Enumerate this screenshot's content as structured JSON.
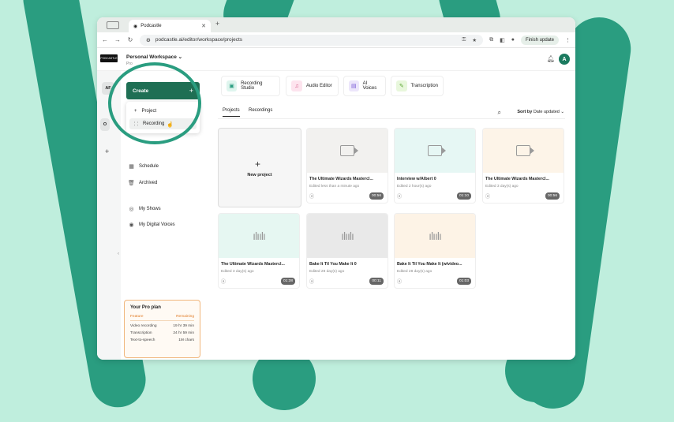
{
  "browser": {
    "tab_title": "Podcastle",
    "url": "podcastle.ai/editor/workspace/projects",
    "finish_update": "Finish update"
  },
  "app": {
    "logo": "PODCASTLE",
    "workspace_name": "Personal Workspace",
    "workspace_plan": "Pro",
    "avatar_initial": "A",
    "rail": [
      "AF",
      "O"
    ]
  },
  "sidebar": {
    "create_label": "Create",
    "create_plus": "+",
    "menu": [
      {
        "label": "Project",
        "icon": "plus-icon"
      },
      {
        "label": "Recording",
        "icon": "grid-icon"
      }
    ],
    "nav": [
      {
        "label": "Schedule",
        "icon": "calendar-icon"
      },
      {
        "label": "Archived",
        "icon": "trash-icon"
      },
      {
        "label": "My Shows",
        "icon": "broadcast-icon"
      },
      {
        "label": "My Digital Voices",
        "icon": "voice-icon"
      }
    ]
  },
  "plan": {
    "title": "Your Pro plan",
    "col_feature": "Feature",
    "col_remaining": "Remaining",
    "rows": [
      {
        "feature": "Video recording",
        "remaining": "19 hr 39 min"
      },
      {
        "feature": "Transcription",
        "remaining": "24 hr 59 min"
      },
      {
        "feature": "Text-to-speech",
        "remaining": "1M chars"
      }
    ]
  },
  "tools": [
    {
      "label": "Recording Studio",
      "color": "#dff5ee"
    },
    {
      "label": "Audio Editor",
      "color": "#fde4ee"
    },
    {
      "label": "AI Voices",
      "color": "#ece6fb"
    },
    {
      "label": "Transcription",
      "color": "#e8f7dc"
    }
  ],
  "tabs": {
    "projects": "Projects",
    "recordings": "Recordings"
  },
  "sort": {
    "label": "Sort by",
    "value": "Date updated"
  },
  "new_project": "New project",
  "cards": [
    {
      "title": "The Ultimate Wizards Mastercl...",
      "sub": "Edited less than a minute ago",
      "dur": "00:56",
      "kind": "video",
      "bg": "#f2f1ef"
    },
    {
      "title": "Interview w/Albert 0",
      "sub": "Edited 2 hour(s) ago",
      "dur": "01:10",
      "kind": "video",
      "bg": "#e6f7f4"
    },
    {
      "title": "The Ultimate Wizards Mastercl...",
      "sub": "Edited 3 day(s) ago",
      "dur": "00:56",
      "kind": "video",
      "bg": "#fdf4e8"
    },
    {
      "title": "The Ultimate Wizards Mastercl...",
      "sub": "Edited 3 day(s) ago",
      "dur": "01:38",
      "kind": "audio",
      "bg": "#e6f7f2"
    },
    {
      "title": "Bake It Til You Make It 0",
      "sub": "Edited 28 day(s) ago",
      "dur": "00:11",
      "kind": "audio",
      "bg": "#e9e9e9"
    },
    {
      "title": "Bake It Til You Make It (w/video...",
      "sub": "Edited 28 day(s) ago",
      "dur": "01:03",
      "kind": "audio",
      "bg": "#fdf3e6"
    }
  ]
}
